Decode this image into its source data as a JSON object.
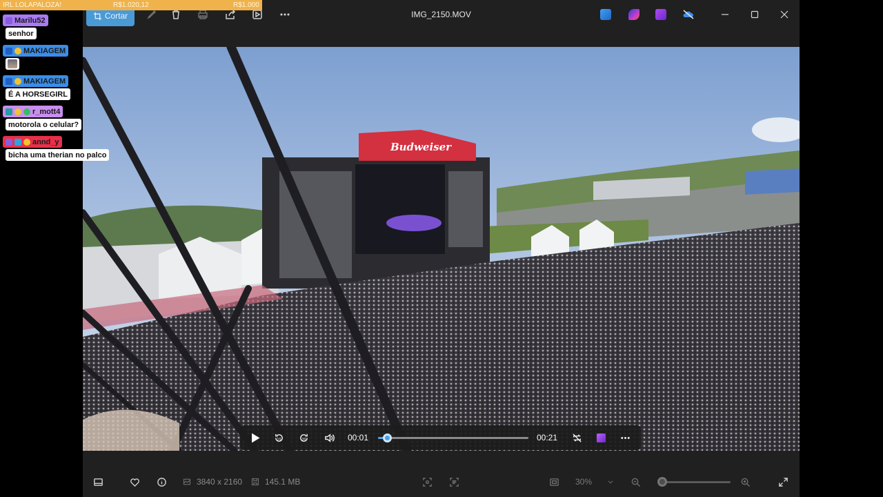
{
  "stream": {
    "banner_title": "IRL LOLAPALOZA!",
    "amount_1": "R$1.020,12",
    "amount_2": "R$1.000",
    "banner_color": "#f0b24a"
  },
  "chat": [
    {
      "name": "Marilu52",
      "name_color": "#a97bf2",
      "message": "senhor"
    },
    {
      "name": "MAKIAGEM",
      "name_color": "#3a8ee8",
      "message": ""
    },
    {
      "name": "MAKIAGEM",
      "name_color": "#3a8ee8",
      "message": "É A HORSEGIRL"
    },
    {
      "name": "r_mott4",
      "name_color": "#c98ef0",
      "message": "motorola o celular?"
    },
    {
      "name": "annd_y",
      "name_color": "#e8304a",
      "message": "bicha uma therian no palco"
    }
  ],
  "window": {
    "title": "IMG_2150.MOV",
    "crop_label": "Cortar",
    "accent": "#4a9ad6"
  },
  "player": {
    "current_time": "00:01",
    "duration": "00:21",
    "progress": 0.06
  },
  "bottombar": {
    "resolution": "3840 x 2160",
    "file_size": "145.1 MB",
    "zoom_label": "30%",
    "zoom_level": 0.05
  },
  "scene": {
    "stage_sign": "Budweiser"
  },
  "icons": {
    "titlebar": [
      "crop-icon",
      "edit-icon",
      "delete-icon",
      "print-icon",
      "share-icon",
      "clip-icon",
      "more-icon"
    ],
    "apps": [
      "app-icon-blue",
      "app-icon-clipchamp",
      "app-icon-purple",
      "app-icon-cloud"
    ],
    "window_controls": [
      "minimize-icon",
      "maximize-icon",
      "close-icon"
    ],
    "player": [
      "play-icon",
      "rewind-10-icon",
      "forward-30-icon",
      "volume-icon",
      "repeat-off-icon",
      "clipchamp-icon",
      "more-icon"
    ],
    "bottombar": [
      "filmstrip-icon",
      "favorite-icon",
      "info-icon",
      "resolution-icon",
      "file-size-icon",
      "fit-icon",
      "ocr-icon",
      "actual-size-icon",
      "chevron-down-icon",
      "zoom-out-icon",
      "zoom-in-icon",
      "fullscreen-icon"
    ]
  }
}
